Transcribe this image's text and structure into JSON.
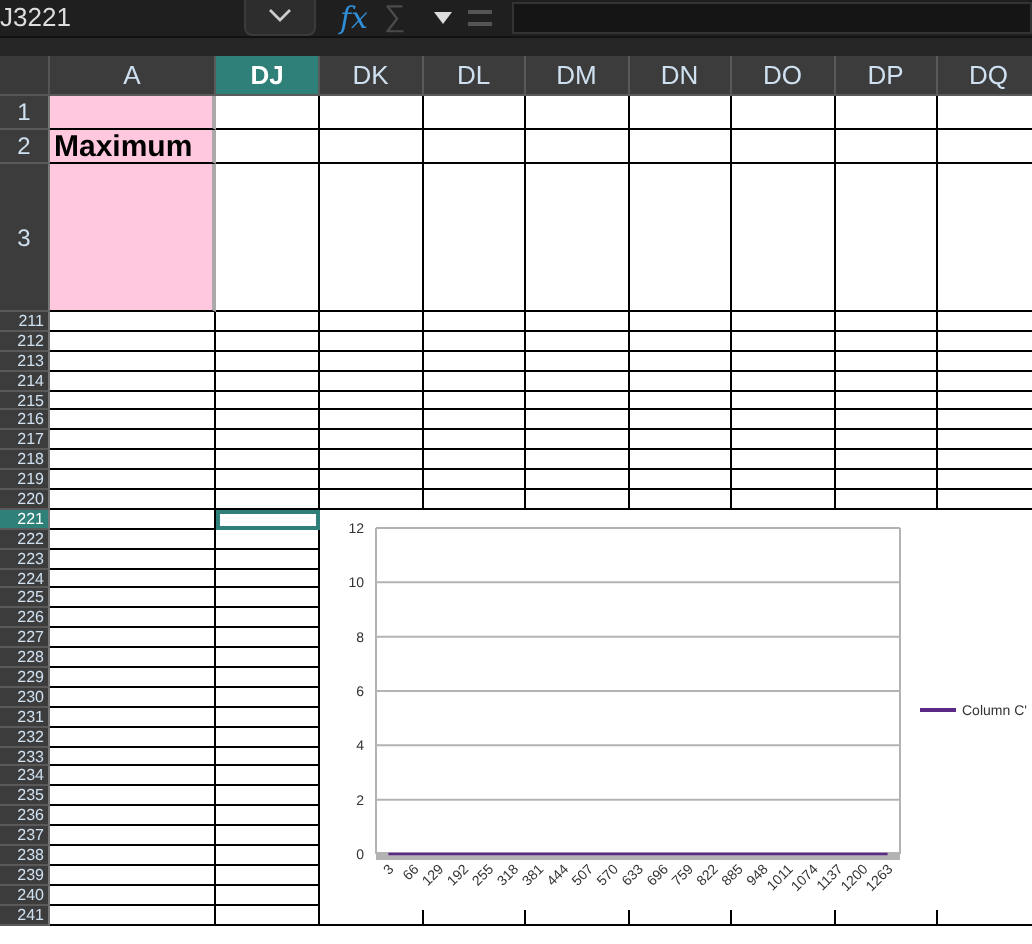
{
  "toolbar": {
    "name_box": "J3221",
    "fx": "fx",
    "sigma": "∑"
  },
  "columns": [
    {
      "label": "A",
      "selected": false
    },
    {
      "label": "DJ",
      "selected": true
    },
    {
      "label": "DK",
      "selected": false
    },
    {
      "label": "DL",
      "selected": false
    },
    {
      "label": "DM",
      "selected": false
    },
    {
      "label": "DN",
      "selected": false
    },
    {
      "label": "DO",
      "selected": false
    },
    {
      "label": "DP",
      "selected": false
    },
    {
      "label": "DQ",
      "selected": false
    }
  ],
  "rows": [
    {
      "label": "1",
      "selected": false,
      "kind": "normal",
      "highlighted": true,
      "a_text": ""
    },
    {
      "label": "2",
      "selected": false,
      "kind": "normal",
      "highlighted": true,
      "a_text": "Maximum"
    },
    {
      "label": "3",
      "selected": false,
      "kind": "tall",
      "highlighted": true,
      "a_text": ""
    },
    {
      "label": "211",
      "selected": false,
      "kind": "compact",
      "highlighted": false
    },
    {
      "label": "212",
      "selected": false,
      "kind": "compact",
      "highlighted": false
    },
    {
      "label": "213",
      "selected": false,
      "kind": "compact",
      "highlighted": false
    },
    {
      "label": "214",
      "selected": false,
      "kind": "compact",
      "highlighted": false
    },
    {
      "label": "215",
      "selected": false,
      "kind": "compact",
      "highlighted": false
    },
    {
      "label": "216",
      "selected": false,
      "kind": "compact",
      "highlighted": false
    },
    {
      "label": "217",
      "selected": false,
      "kind": "compact",
      "highlighted": false
    },
    {
      "label": "218",
      "selected": false,
      "kind": "compact",
      "highlighted": false
    },
    {
      "label": "219",
      "selected": false,
      "kind": "compact",
      "highlighted": false
    },
    {
      "label": "220",
      "selected": false,
      "kind": "compact",
      "highlighted": false
    },
    {
      "label": "221",
      "selected": true,
      "kind": "compact",
      "highlighted": false
    },
    {
      "label": "222",
      "selected": false,
      "kind": "compact",
      "highlighted": false
    },
    {
      "label": "223",
      "selected": false,
      "kind": "compact",
      "highlighted": false
    },
    {
      "label": "224",
      "selected": false,
      "kind": "compact",
      "highlighted": false
    },
    {
      "label": "225",
      "selected": false,
      "kind": "compact",
      "highlighted": false
    },
    {
      "label": "226",
      "selected": false,
      "kind": "compact",
      "highlighted": false
    },
    {
      "label": "227",
      "selected": false,
      "kind": "compact",
      "highlighted": false
    },
    {
      "label": "228",
      "selected": false,
      "kind": "compact",
      "highlighted": false
    },
    {
      "label": "229",
      "selected": false,
      "kind": "compact",
      "highlighted": false
    },
    {
      "label": "230",
      "selected": false,
      "kind": "compact",
      "highlighted": false
    },
    {
      "label": "231",
      "selected": false,
      "kind": "compact",
      "highlighted": false
    },
    {
      "label": "232",
      "selected": false,
      "kind": "compact",
      "highlighted": false
    },
    {
      "label": "233",
      "selected": false,
      "kind": "compact",
      "highlighted": false
    },
    {
      "label": "234",
      "selected": false,
      "kind": "compact",
      "highlighted": false
    },
    {
      "label": "235",
      "selected": false,
      "kind": "compact",
      "highlighted": false
    },
    {
      "label": "236",
      "selected": false,
      "kind": "compact",
      "highlighted": false
    },
    {
      "label": "237",
      "selected": false,
      "kind": "compact",
      "highlighted": false
    },
    {
      "label": "238",
      "selected": false,
      "kind": "compact",
      "highlighted": false
    },
    {
      "label": "239",
      "selected": false,
      "kind": "compact",
      "highlighted": false
    },
    {
      "label": "240",
      "selected": false,
      "kind": "compact",
      "highlighted": false
    },
    {
      "label": "241",
      "selected": false,
      "kind": "compact",
      "highlighted": false
    }
  ],
  "chart": {
    "chart_data": {
      "type": "line",
      "categories": [
        "3",
        "66",
        "129",
        "192",
        "255",
        "318",
        "381",
        "444",
        "507",
        "570",
        "633",
        "696",
        "759",
        "822",
        "885",
        "948",
        "1011",
        "1074",
        "1137",
        "1200",
        "1263"
      ],
      "series": [
        {
          "name": "Column C'",
          "color": "#5b2a86",
          "values": [
            0,
            0,
            0,
            0,
            0,
            0,
            0,
            0,
            0,
            0,
            0,
            0,
            0,
            0,
            0,
            0,
            0,
            0,
            0,
            0,
            0
          ]
        }
      ],
      "grid": true,
      "ylim": [
        0,
        12
      ],
      "yticks": [
        0,
        2,
        4,
        6,
        8,
        10,
        12
      ]
    }
  }
}
